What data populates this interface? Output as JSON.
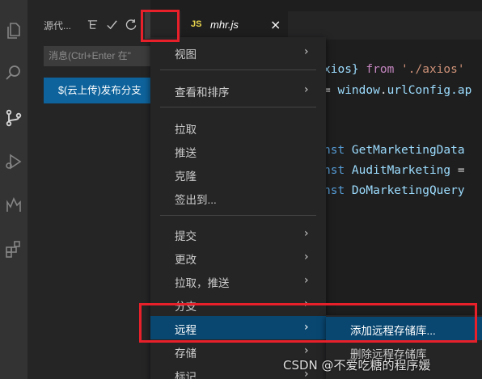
{
  "sidebar": {
    "title": "源代...",
    "message_placeholder": "消息(Ctrl+Enter 在\"",
    "publish_button": "$(云上传)发布分支"
  },
  "editor": {
    "tab": {
      "lang": "JS",
      "filename": "mhr.js",
      "close": "×"
    },
    "code_lines": [
      [
        {
          "t": "xios} ",
          "c": "var"
        },
        {
          "t": "from ",
          "c": "ctl"
        },
        {
          "t": "'./axios'",
          "c": "str"
        }
      ],
      [
        {
          "t": "= ",
          "c": "pl"
        },
        {
          "t": "window",
          "c": "var"
        },
        {
          "t": ".",
          "c": "pl"
        },
        {
          "t": "urlConfig",
          "c": "var"
        },
        {
          "t": ".ap",
          "c": "var"
        }
      ],
      [
        {
          "t": "nst ",
          "c": "kw"
        },
        {
          "t": "GetMarketingData",
          "c": "var"
        }
      ],
      [
        {
          "t": "nst ",
          "c": "kw"
        },
        {
          "t": "AuditMarketing ",
          "c": "var"
        },
        {
          "t": "=",
          "c": "pl"
        }
      ],
      [
        {
          "t": "nst ",
          "c": "kw"
        },
        {
          "t": "DoMarketingQuery",
          "c": "var"
        }
      ]
    ]
  },
  "menu": {
    "items": [
      {
        "label": "视图",
        "submenu": true
      },
      {
        "label": "查看和排序",
        "submenu": true
      },
      {
        "label": "拉取",
        "submenu": false
      },
      {
        "label": "推送",
        "submenu": false
      },
      {
        "label": "克隆",
        "submenu": false
      },
      {
        "label": "签出到...",
        "submenu": false
      },
      {
        "label": "提交",
        "submenu": true
      },
      {
        "label": "更改",
        "submenu": true
      },
      {
        "label": "拉取，推送",
        "submenu": true
      },
      {
        "label": "分支",
        "submenu": true
      },
      {
        "label": "远程",
        "submenu": true,
        "active": true
      },
      {
        "label": "存储",
        "submenu": true
      },
      {
        "label": "标记",
        "submenu": true
      }
    ],
    "more_label": "···",
    "arrow": "›"
  },
  "submenu": {
    "items": [
      {
        "label": "添加远程存储库...",
        "active": true
      },
      {
        "label": "删除远程存储库"
      }
    ]
  },
  "watermark": "CSDN @不爱吃糖的程序媛",
  "colors": {
    "accent": "#0e639c",
    "selection": "#094771",
    "highlight_box": "#e8202a",
    "js_badge": "#e8d44d"
  }
}
